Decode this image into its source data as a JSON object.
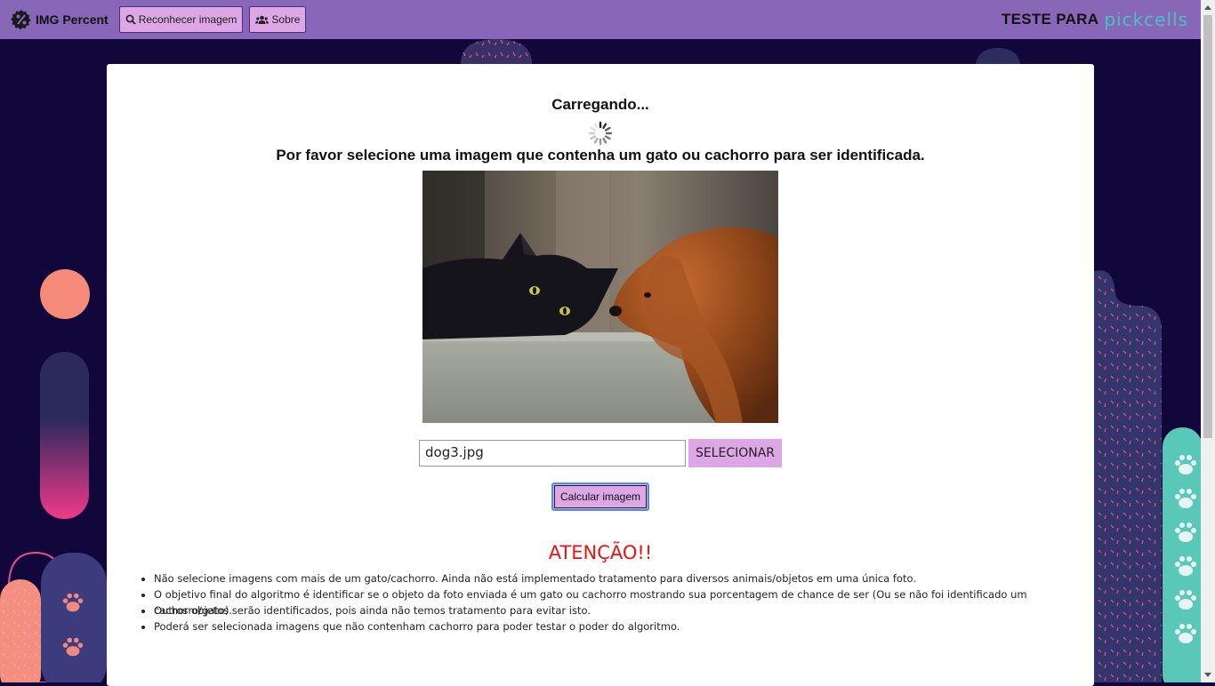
{
  "navbar": {
    "brand": "IMG Percent",
    "buttons": [
      {
        "label": "Reconhecer imagem",
        "icon": "search-icon"
      },
      {
        "label": "Sobre",
        "icon": "users-icon"
      }
    ],
    "right_text": "TESTE PARA",
    "right_logo": "pickcells"
  },
  "main": {
    "loading": "Carregando...",
    "instruction": "Por favor selecione uma imagem que contenha um gato ou cachorro para ser identificada.",
    "file_value": "dog3.jpg",
    "select_label": "SELECIONAR",
    "calc_label": "Calcular imagem",
    "attention": "ATENÇÃO!!",
    "notes": [
      "Não selecione imagens com mais de um gato/cachorro. Ainda não está implementado tratamento para diversos animais/objetos em uma única foto.",
      "O objetivo final do algoritmo é identificar se o objeto da foto enviada é um gato ou cachorro mostrando sua porcentagem de chance de ser (Ou se não foi identificado um cachorro/gato).",
      "Outros objetos serão identificados, pois ainda não temos tratamento para evitar isto.",
      "Poderá ser selecionada imagens que não contenham cachorro para poder testar o poder do algoritmo."
    ]
  },
  "colors": {
    "navbar": "#8866b8",
    "button": "#dda6e4",
    "background": "#12073a",
    "attention": "#ee1111",
    "logo_accent": "#49c3c6"
  }
}
